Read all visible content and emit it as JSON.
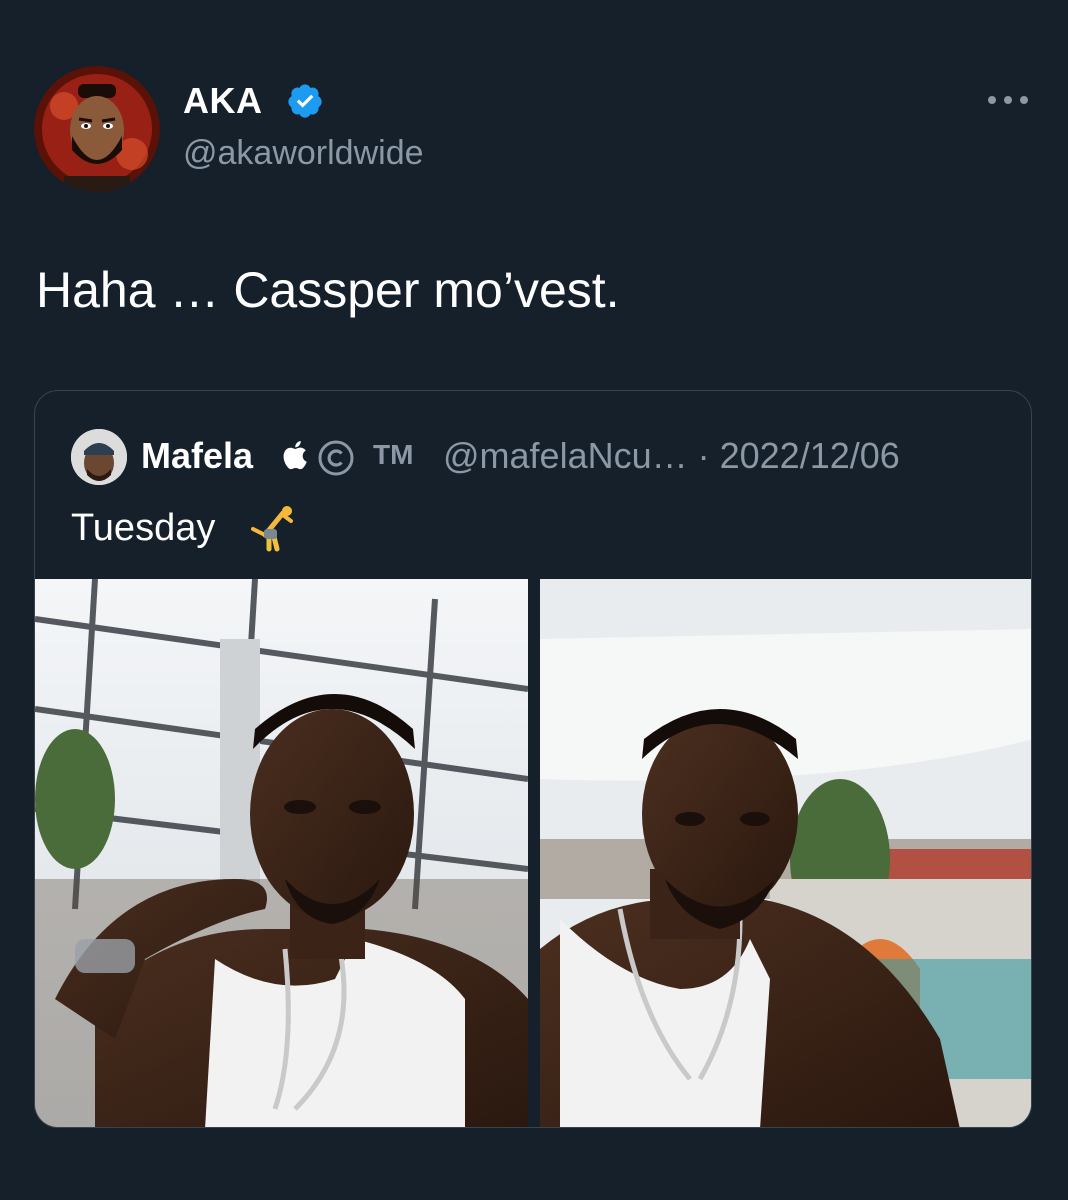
{
  "tweet": {
    "author_name": "AKA",
    "author_handle": "@akaworldwide",
    "text": "Haha … Cassper mo’vest."
  },
  "quoted": {
    "author_name": "Mafela",
    "tm": "TM",
    "handle_date": "@mafelaNcu… · 2022/12/06",
    "text": "Tuesday"
  },
  "icons": {
    "verified": "verified-badge-icon",
    "more": "more-options-icon",
    "apple": "apple-logo-icon",
    "copyright": "copyright-icon",
    "emoji": "person-cartwheeling-emoji"
  },
  "colors": {
    "background": "#15202b",
    "secondary_text": "#8b98a5",
    "verified_blue": "#1d9bf0",
    "border": "#38444d"
  }
}
